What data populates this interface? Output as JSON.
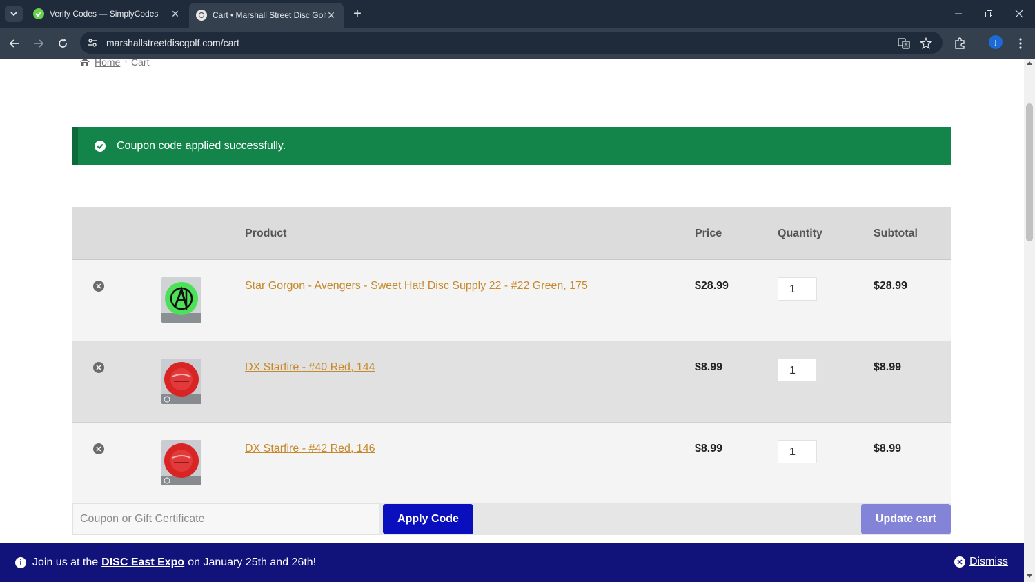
{
  "browser": {
    "tabs": [
      {
        "title": "Verify Codes — SimplyCodes",
        "icon": "simplycodes-favicon",
        "active": false
      },
      {
        "title": "Cart • Marshall Street Disc Golf",
        "icon": "disc-golf-favicon",
        "active": true
      }
    ],
    "url": "marshallstreetdiscgolf.com/cart",
    "profile_initial": "j"
  },
  "breadcrumb": {
    "home": "Home",
    "current": "Cart"
  },
  "notice": {
    "text": "Coupon code applied successfully.",
    "color": "#13854b"
  },
  "cart": {
    "headers": {
      "product": "Product",
      "price": "Price",
      "quantity": "Quantity",
      "subtotal": "Subtotal"
    },
    "items": [
      {
        "name": "Star Gorgon - Avengers - Sweet Hat! Disc Supply 22 - #22 Green, 175",
        "price": "$28.99",
        "quantity": "1",
        "subtotal": "$28.99",
        "disc_color": "#4fe05a"
      },
      {
        "name": "DX Starfire - #40 Red, 144",
        "price": "$8.99",
        "quantity": "1",
        "subtotal": "$8.99",
        "disc_color": "#d92424"
      },
      {
        "name": "DX Starfire - #42 Red, 146",
        "price": "$8.99",
        "quantity": "1",
        "subtotal": "$8.99",
        "disc_color": "#d92424"
      }
    ]
  },
  "actions": {
    "coupon_placeholder": "Coupon or Gift Certificate",
    "apply_label": "Apply Code",
    "update_label": "Update cart"
  },
  "banner": {
    "prefix": "Join us at the",
    "link": "DISC East Expo",
    "suffix": "on January 25th and 26th!",
    "dismiss": "Dismiss"
  }
}
